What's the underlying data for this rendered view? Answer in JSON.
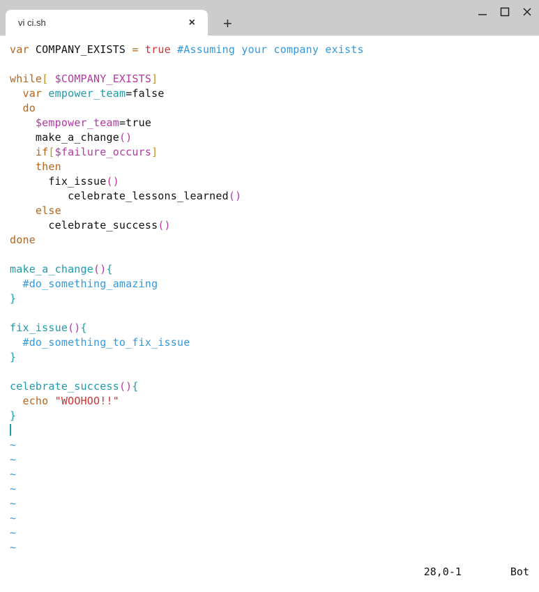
{
  "window": {
    "tab_title": "vi ci.sh",
    "close_glyph": "×",
    "new_tab_glyph": "+"
  },
  "status": {
    "position": "28,0-1",
    "location": "Bot"
  },
  "tilde": "~",
  "code": {
    "l1": {
      "a": "var",
      "b": " COMPANY_EXISTS ",
      "c": "=",
      "d": " ",
      "e": "true",
      "f": " ",
      "g": "#Assuming your company exists"
    },
    "l2": "",
    "l3": {
      "a": "while",
      "b": "[",
      "c": " ",
      "d": "$COMPANY_EXISTS",
      "e": "]"
    },
    "l4": {
      "a": "  ",
      "b": "var",
      "c": " ",
      "d": "empower_team",
      "e": "=false"
    },
    "l5": {
      "a": "  ",
      "b": "do"
    },
    "l6": {
      "a": "    ",
      "b": "$empower_team",
      "c": "=true"
    },
    "l7": {
      "a": "    make_a_change",
      "b": "()"
    },
    "l8": {
      "a": "    ",
      "b": "if",
      "c": "[",
      "d": "$failure_occurs",
      "e": "]"
    },
    "l9": {
      "a": "    ",
      "b": "then"
    },
    "l10": {
      "a": "      fix_issue",
      "b": "()"
    },
    "l11": {
      "a": "         celebrate_lessons_learned",
      "b": "()"
    },
    "l12": {
      "a": "    ",
      "b": "else"
    },
    "l13": {
      "a": "      celebrate_success",
      "b": "()"
    },
    "l14": {
      "a": "done"
    },
    "l15": "",
    "l16": {
      "a": "make_a_change",
      "b": "()",
      "c": "{"
    },
    "l17": {
      "a": "  ",
      "b": "#do_something_amazing"
    },
    "l18": {
      "a": "}"
    },
    "l19": "",
    "l20": {
      "a": "fix_issue",
      "b": "()",
      "c": "{"
    },
    "l21": {
      "a": "  ",
      "b": "#do_something_to_fix_issue"
    },
    "l22": {
      "a": "}"
    },
    "l23": "",
    "l24": {
      "a": "celebrate_success",
      "b": "()",
      "c": "{"
    },
    "l25": {
      "a": "  ",
      "b": "echo",
      "c": " ",
      "d": "\"WOOHOO!!\""
    },
    "l26": {
      "a": "}"
    }
  }
}
